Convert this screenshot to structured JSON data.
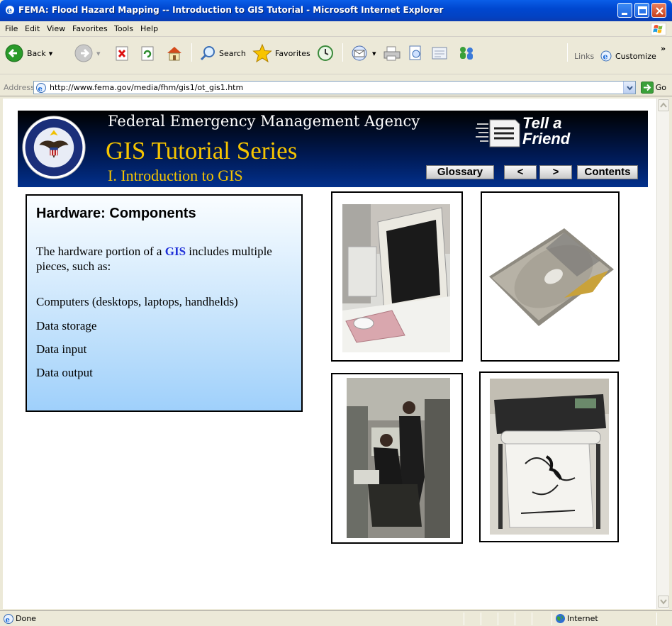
{
  "window": {
    "title": "FEMA: Flood Hazard Mapping -- Introduction to GIS Tutorial - Microsoft Internet Explorer"
  },
  "menu": [
    "File",
    "Edit",
    "View",
    "Favorites",
    "Tools",
    "Help"
  ],
  "toolbar": {
    "back_label": "Back",
    "search_label": "Search",
    "favorites_label": "Favorites",
    "links_label": "Links",
    "customize_label": "Customize"
  },
  "address": {
    "label": "Address",
    "url": "http://www.fema.gov/media/fhm/gis1/ot_gis1.htm",
    "go_label": "Go"
  },
  "banner": {
    "agency": "Federal Emergency Management Agency",
    "series": "GIS Tutorial Series",
    "subtitle": "I. Introduction to GIS",
    "tell_a_friend_line1": "Tell a",
    "tell_a_friend_line2": "Friend",
    "glossary_label": "Glossary",
    "prev_label": "<",
    "next_label": ">",
    "contents_label": "Contents"
  },
  "panel": {
    "heading": "Hardware:  Components",
    "intro_before": "The hardware portion of a ",
    "intro_link": "GIS",
    "intro_after": " includes multiple pieces, such as:",
    "items": [
      "Computers (desktops, laptops, handhelds)",
      "Data storage",
      "Data input",
      "Data output"
    ]
  },
  "status": {
    "left": "Done",
    "zone": "Internet"
  },
  "colors": {
    "xp_blue": "#0047d0",
    "banner_navy": "#001a55",
    "title_gold": "#f5c400",
    "link_blue": "#1f2fd8"
  }
}
